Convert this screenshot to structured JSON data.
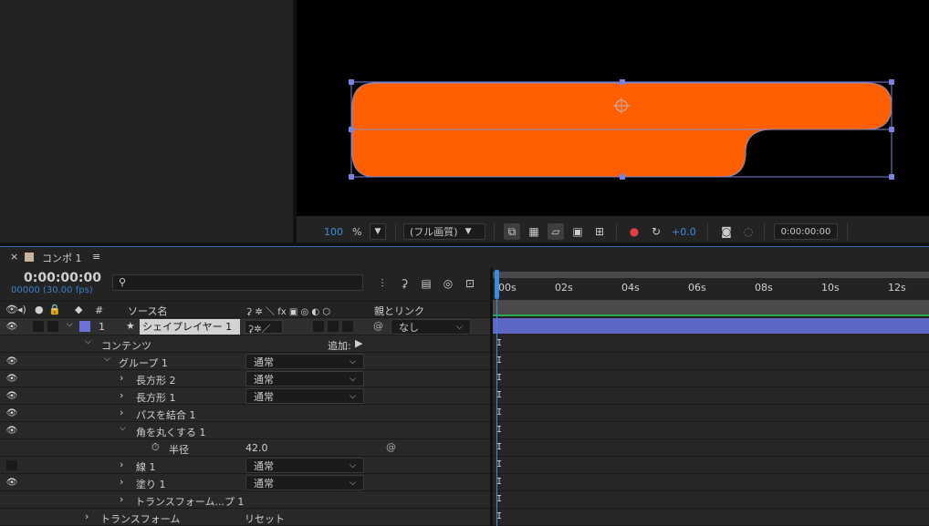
{
  "viewer": {
    "zoom_value": "100",
    "zoom_unit": "%",
    "resolution": "(フル画質)",
    "exposure": "+0.0",
    "timecode": "0:00:00:00",
    "shape_color": "#ff5f00"
  },
  "timeline": {
    "close_glyph": "×",
    "comp_name": "コンポ 1",
    "menu_glyph": "≡",
    "current_time": "0:00:00:00",
    "frame_fps": "00000 (30.00 fps)",
    "search_placeholder": "",
    "headers": {
      "hash": "#",
      "source_name": "ソース名",
      "switches": "⚳ ✲ ＼ fx ▣ ◎ ◐ ⬡",
      "parent_link": "親とリンク"
    },
    "ruler_ticks": [
      "00s",
      "02s",
      "04s",
      "06s",
      "08s",
      "10s",
      "12s"
    ],
    "layer": {
      "number": "1",
      "star": "★",
      "name": "シェイプレイヤー 1",
      "parent": "なし",
      "color": "#6b73d8"
    },
    "rows": {
      "contents": "コンテンツ",
      "add": "追加:",
      "group1": "グループ 1",
      "group1_mode": "通常",
      "rect2": "長方形 2",
      "rect2_mode": "通常",
      "rect1": "長方形 1",
      "rect1_mode": "通常",
      "merge": "パスを結合 1",
      "round": "角を丸くする 1",
      "radius": "半径",
      "radius_value": "42.0",
      "stroke": "線 1",
      "stroke_mode": "通常",
      "fill": "塗り 1",
      "fill_mode": "通常",
      "transform_group": "トランスフォーム...プ 1",
      "transform": "トランスフォーム",
      "reset": "リセット"
    }
  }
}
